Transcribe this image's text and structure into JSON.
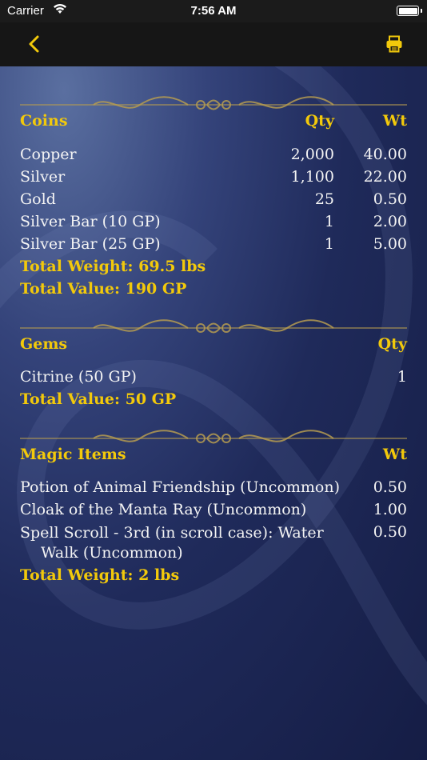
{
  "status_bar": {
    "carrier": "Carrier",
    "time": "7:56 AM"
  },
  "nav": {
    "back_icon": "chevron-left-icon",
    "print_icon": "printer-icon",
    "accent": "#f2c90b"
  },
  "coins": {
    "title": "Coins",
    "qty_header": "Qty",
    "wt_header": "Wt",
    "items": [
      {
        "name": "Copper",
        "qty": "2,000",
        "wt": "40.00"
      },
      {
        "name": "Silver",
        "qty": "1,100",
        "wt": "22.00"
      },
      {
        "name": "Gold",
        "qty": "25",
        "wt": "0.50"
      },
      {
        "name": "Silver Bar (10 GP)",
        "qty": "1",
        "wt": "2.00"
      },
      {
        "name": "Silver Bar (25 GP)",
        "qty": "1",
        "wt": "5.00"
      }
    ],
    "total_weight": "Total Weight:  69.5 lbs",
    "total_value": "Total Value:  190 GP"
  },
  "gems": {
    "title": "Gems",
    "qty_header": "Qty",
    "items": [
      {
        "name": "Citrine (50 GP)",
        "qty": "1"
      }
    ],
    "total_value": "Total Value:  50 GP"
  },
  "magic_items": {
    "title": "Magic Items",
    "wt_header": "Wt",
    "items": [
      {
        "name": "Potion of Animal Friendship (Uncommon)",
        "wt": "0.50"
      },
      {
        "name": "Cloak of the Manta Ray (Uncommon)",
        "wt": "1.00"
      },
      {
        "name_line1": "Spell Scroll - 3rd (in scroll case): Water",
        "name_line2": "Walk (Uncommon)",
        "wt": "0.50"
      }
    ],
    "total_weight": "Total Weight:  2 lbs"
  }
}
